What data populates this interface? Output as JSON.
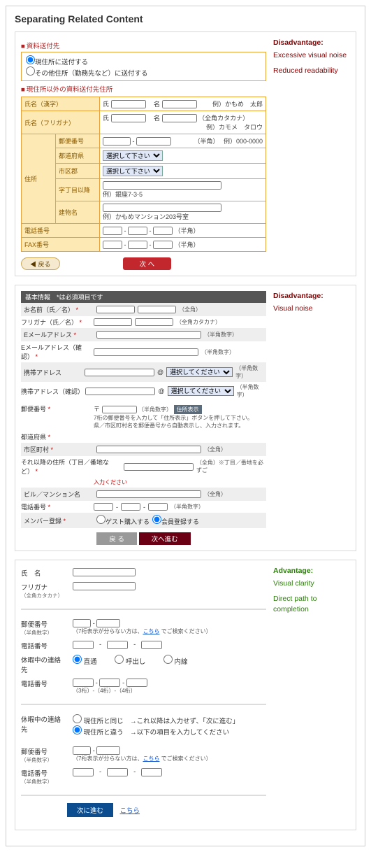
{
  "page_title": "Separating Related Content",
  "annotations": {
    "ex1_title": "Disadvantage:",
    "ex1_line1": "Excessive visual noise",
    "ex1_line2": "Reduced readability",
    "ex2_title": "Disadvantage:",
    "ex2_line1": "Visual noise",
    "ex3_title": "Advantage:",
    "ex3_line1": "Visual clarity",
    "ex3_line2": "Direct path to completion"
  },
  "ex1": {
    "sec1": "資料送付先",
    "radio1": "現住所に送付する",
    "radio2": "その他住所（勤務先など）に送付する",
    "sec2": "現住所以外の資料送付先住所",
    "row_kanji": "氏名（漢字）",
    "row_furigana": "氏名（フリガナ）",
    "lab_shi": "氏",
    "lab_mei": "名",
    "note_kana": "（全角カタカナ）",
    "eg_kanji": "例）かもめ　太郎",
    "eg_kana": "例）カモメ　タロウ",
    "addr": "住所",
    "zip": "郵便番号",
    "zip_note": "（半角）",
    "zip_eg": "例）000-0000",
    "pref": "都道府県",
    "city": "市区郡",
    "select_ph": "選択して下さい",
    "aza": "字丁目以降",
    "aza_eg": "例）銀座7-3-5",
    "bldg": "建物名",
    "bldg_eg": "例）かもめマンション203号室",
    "tel": "電話番号",
    "fax": "FAX番号",
    "half": "（半角）",
    "btn_back": "◀ 戻る",
    "btn_next": "次 へ"
  },
  "ex2": {
    "header": "基本情報　*は必須項目です",
    "name": "お名前（氏／名）",
    "furigana": "フリガナ（氏／名）",
    "hint_full": "（全角）",
    "hint_kana": "（全角カタカナ）",
    "email": "Eメールアドレス",
    "email2": "Eメールアドレス（確認）",
    "hint_half": "（半角数字）",
    "mobile": "携帯アドレス",
    "mobile2": "携帯アドレス（確認）",
    "select_ph": "選択してください",
    "zip": "郵便番号",
    "zip_sym": "〒",
    "zip_btn": "住所表示",
    "zip_hint": "7桁の郵便番号を入力して「住所表示」ボタンを押して下さい。\n県／市区町村名を郵便番号から自動表示し、入力されます。",
    "pref": "都道府県",
    "city": "市区町村",
    "addr2": "それ以降の住所（丁目／番地など）",
    "addr2_hint": "入力ください",
    "addr2_note": "（全角）※丁目／番地を必ずご",
    "bldg": "ビル／マンション名",
    "tel": "電話番号",
    "member": "メンバー登録",
    "m_guest": "ゲスト購入する",
    "m_member": "会員登録する",
    "btn_back": "戻 る",
    "btn_next": "次へ進む"
  },
  "ex3": {
    "name": "氏　名",
    "furigana": "フリガナ",
    "furigana_sub": "（全角カタカナ）",
    "zip": "郵便番号",
    "half_sub": "（半角数字）",
    "zip_hint_pre": "（7桁表示が分らない方は、",
    "zip_link": "こちら",
    "zip_hint_post": " でご検索ください）",
    "tel": "電話番号",
    "holiday": "休暇中の連絡先",
    "opt_direct": "直通",
    "opt_call": "呼出し",
    "opt_int": "内線",
    "tel2": "電話番号",
    "tel_hint": "（3桁）-（4桁）-（4桁）",
    "holiday2": "休暇中の連絡先",
    "h_same": "現住所と同じ　→これ以降は入力せず、「次に進む」",
    "h_diff": "現住所と違う　→以下の項目を入力してください",
    "btn_next": "次に進む",
    "link_clear": "こちら"
  }
}
